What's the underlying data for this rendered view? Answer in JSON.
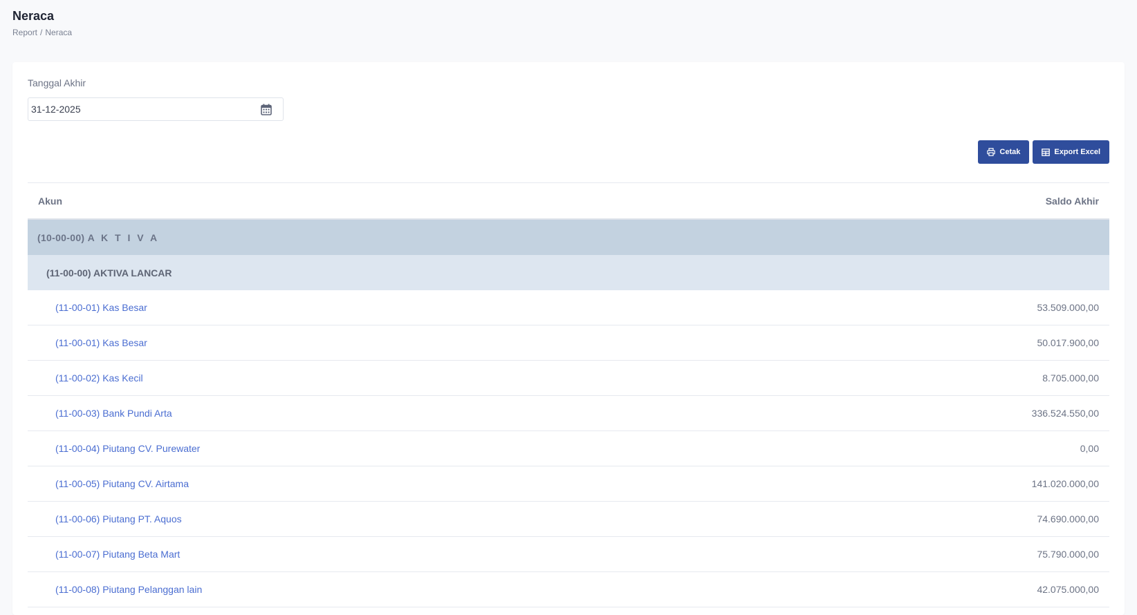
{
  "page": {
    "title": "Neraca",
    "breadcrumb": [
      "Report",
      "/",
      "Neraca"
    ]
  },
  "filter": {
    "label": "Tanggal Akhir",
    "date_value": "31-12-2025",
    "calendar_icon": "calendar-icon"
  },
  "actions": {
    "print_label": "Cetak",
    "print_icon": "printer-icon",
    "export_label": "Export Excel",
    "export_icon": "table-icon",
    "button_color": "#2f4d9c"
  },
  "table": {
    "headers": {
      "account": "Akun",
      "balance": "Saldo Akhir"
    },
    "group_1": {
      "code": "(10-00-00)",
      "name": "A K T I V A"
    },
    "group_2": {
      "code": "(11-00-00)",
      "name": "AKTIVA LANCAR"
    },
    "rows": [
      {
        "code": "(11-00-01)",
        "name": "Kas Besar",
        "balance": "53.509.000,00"
      },
      {
        "code": "(11-00-01)",
        "name": "Kas Besar",
        "balance": "50.017.900,00"
      },
      {
        "code": "(11-00-02)",
        "name": "Kas Kecil",
        "balance": "8.705.000,00"
      },
      {
        "code": "(11-00-03)",
        "name": "Bank Pundi Arta",
        "balance": "336.524.550,00"
      },
      {
        "code": "(11-00-04)",
        "name": "Piutang CV. Purewater",
        "balance": "0,00"
      },
      {
        "code": "(11-00-05)",
        "name": "Piutang CV. Airtama",
        "balance": "141.020.000,00"
      },
      {
        "code": "(11-00-06)",
        "name": "Piutang PT. Aquos",
        "balance": "74.690.000,00"
      },
      {
        "code": "(11-00-07)",
        "name": "Piutang Beta Mart",
        "balance": "75.790.000,00"
      },
      {
        "code": "(11-00-08)",
        "name": "Piutang Pelanggan lain",
        "balance": "42.075.000,00"
      }
    ],
    "colors": {
      "group_1_bg": "#c3d2e0",
      "group_2_bg": "#dde6f0",
      "account_link": "#4a6dd1"
    }
  }
}
